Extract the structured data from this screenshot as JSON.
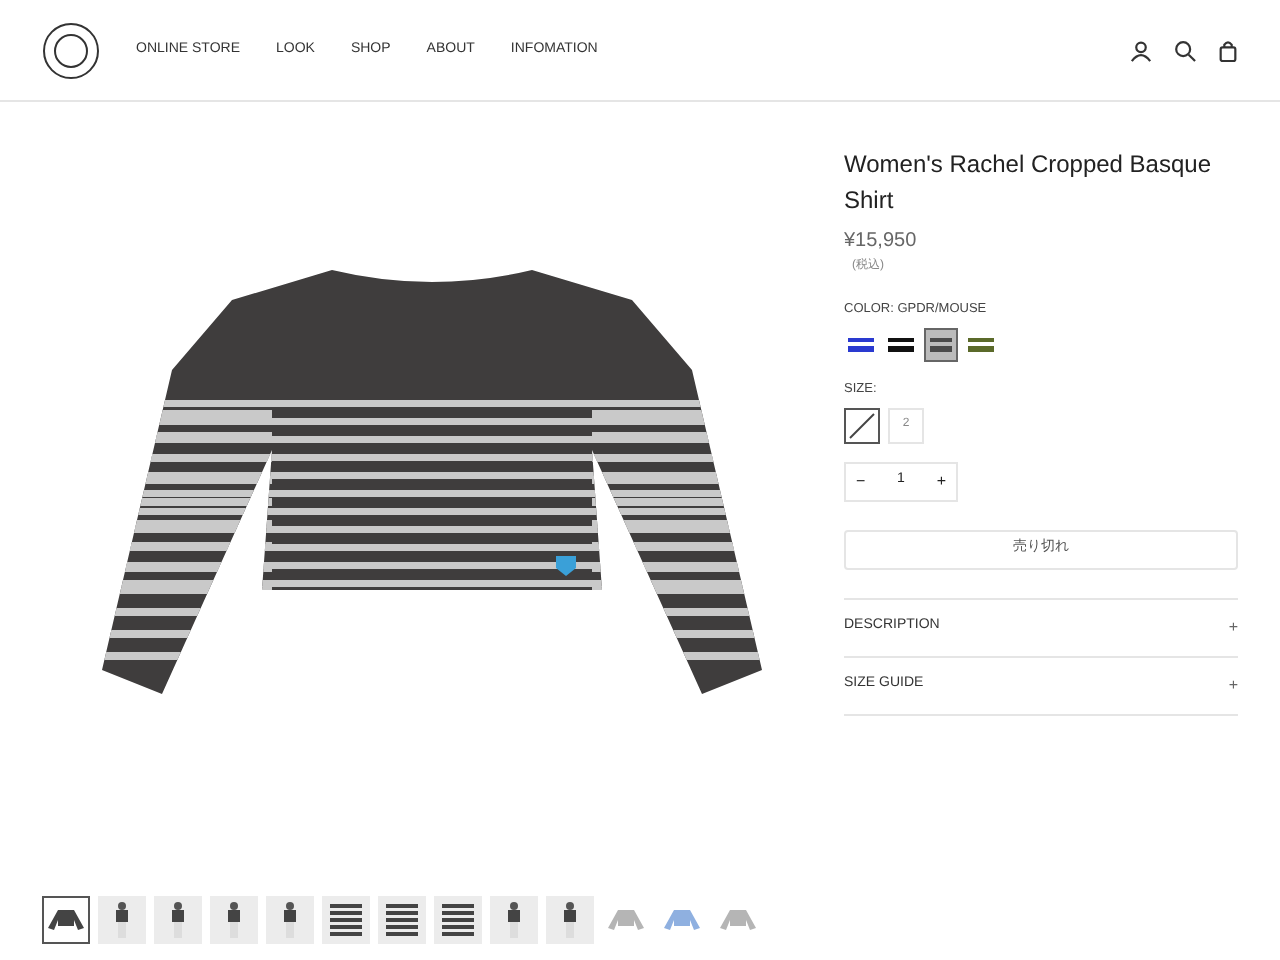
{
  "nav": {
    "items": [
      {
        "label": "ONLINE STORE"
      },
      {
        "label": "LOOK"
      },
      {
        "label": "SHOP"
      },
      {
        "label": "ABOUT"
      },
      {
        "label": "INFOMATION"
      }
    ]
  },
  "product": {
    "title": "Women's Rachel Cropped Basque Shirt",
    "price": "¥15,950",
    "tax_note": "(税込)",
    "color_label": "COLOR: GPDR/MOUSE",
    "swatches": [
      {
        "color": "#2a3ad0",
        "selected": false
      },
      {
        "color": "#111111",
        "selected": false
      },
      {
        "color": "#4a4a4a",
        "selected": true
      },
      {
        "color": "#5b6a2a",
        "selected": false
      }
    ],
    "size_label": "SIZE:",
    "sizes": [
      {
        "sold_out": true,
        "selected": true
      },
      {
        "label": "2",
        "sold_out": false,
        "selected": false
      }
    ],
    "quantity": {
      "minus": "−",
      "value": "1",
      "plus": "+"
    },
    "sold_out_button": "売り切れ",
    "accordions": [
      {
        "label": "DESCRIPTION",
        "icon": "+",
        "expanded": false
      },
      {
        "label": "SIZE GUIDE",
        "icon": "+",
        "expanded": false
      }
    ]
  },
  "thumbnails": [
    {
      "kind": "garment",
      "selected": true
    },
    {
      "kind": "model",
      "selected": false
    },
    {
      "kind": "model",
      "selected": false
    },
    {
      "kind": "model",
      "selected": false
    },
    {
      "kind": "model",
      "selected": false
    },
    {
      "kind": "closeup",
      "selected": false
    },
    {
      "kind": "closeup",
      "selected": false
    },
    {
      "kind": "closeup",
      "selected": false
    },
    {
      "kind": "model",
      "selected": false
    },
    {
      "kind": "model",
      "selected": false
    },
    {
      "kind": "garment",
      "selected": false
    },
    {
      "kind": "garment",
      "selected": false
    },
    {
      "kind": "garment",
      "selected": false
    }
  ]
}
